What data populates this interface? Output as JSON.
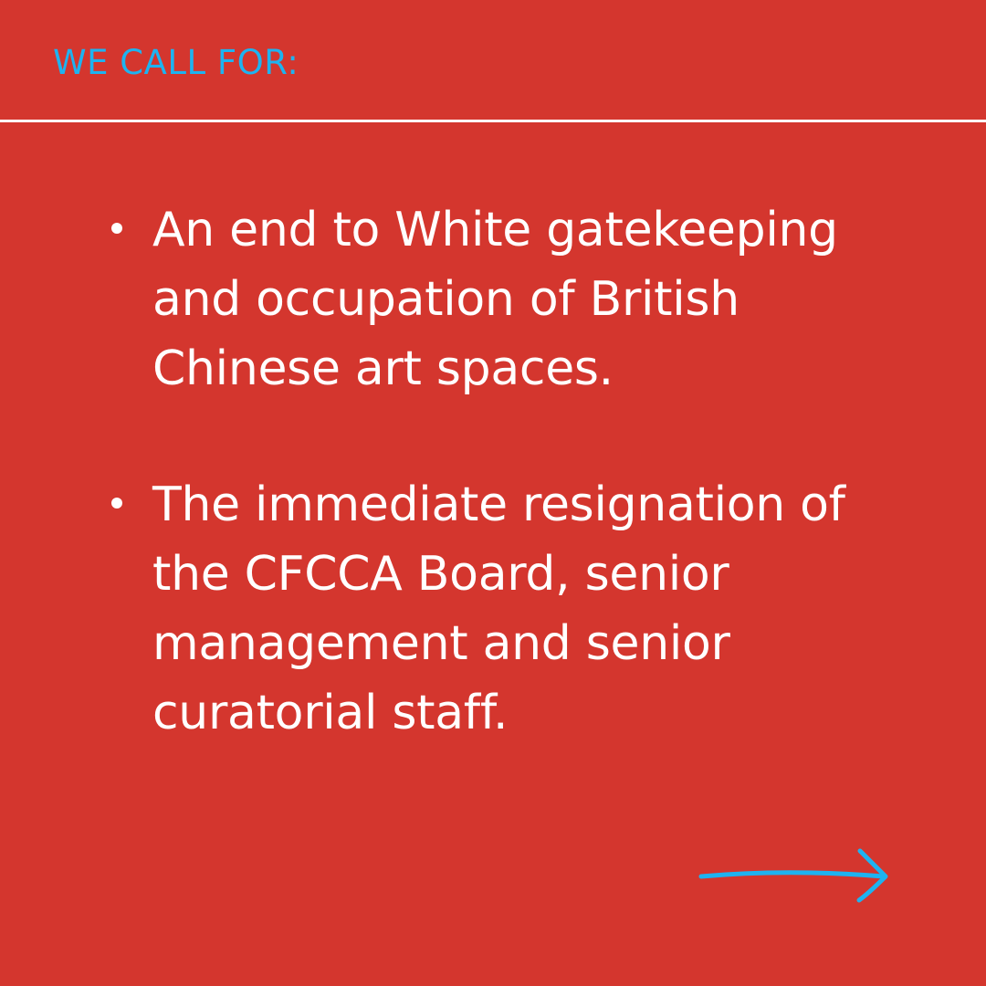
{
  "header": {
    "title": "WE CALL FOR:"
  },
  "demands": [
    {
      "text": "An end to White gatekeeping\nand occupation of British\nChinese art spaces."
    },
    {
      "text": "The immediate resignation of\nthe CFCCA Board, senior\nmanagement and senior\ncuratorial staff."
    }
  ],
  "next_arrow": {
    "icon": "arrow-right-icon"
  },
  "colors": {
    "background": "#D4362E",
    "accent": "#1EB3F0",
    "text": "#FFFFFF"
  }
}
